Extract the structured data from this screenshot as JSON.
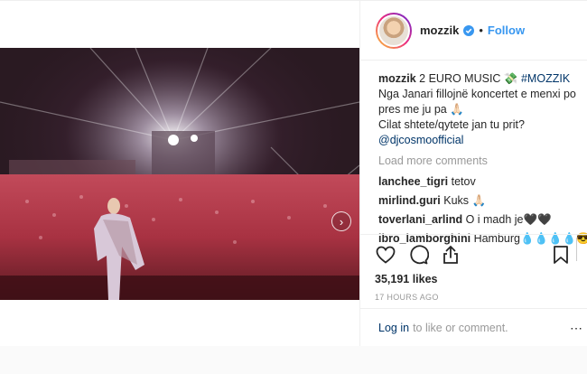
{
  "author": {
    "username": "mozzik",
    "dot": "•",
    "follow_label": "Follow"
  },
  "caption": {
    "username": "mozzik",
    "line1_text": "2 EURO MUSIC 💸",
    "hashtag": "#MOZZIK",
    "line2": "Nga Janari fillojnë koncertet e menxi po",
    "line3": "pres me ju pa 🙏🏻",
    "line4": "Cilat shtete/qytete jan tu prit?",
    "mention": "@djcosmoofficial"
  },
  "load_more_label": "Load more comments",
  "comments": [
    {
      "user": "lanchee_tigri",
      "text": "tetov"
    },
    {
      "user": "mirlind.guri",
      "text": "Kuks 🙏🏻"
    },
    {
      "user": "toverlani_arlind",
      "text": "O i madh je🖤🖤"
    },
    {
      "user": "ibro_lamborghini",
      "text": "Hamburg💧💧💧💧😎"
    }
  ],
  "likes_label": "35,191 likes",
  "timestamp": "17 HOURS AGO",
  "footer": {
    "login_label": "Log in",
    "rest_text": "to like or comment."
  },
  "colors": {
    "accent": "#3897f0",
    "link": "#003569",
    "muted": "#999999"
  },
  "icons": [
    "heart-icon",
    "comment-icon",
    "share-icon",
    "bookmark-icon",
    "verified-icon",
    "chevron-right-icon",
    "more-icon"
  ]
}
